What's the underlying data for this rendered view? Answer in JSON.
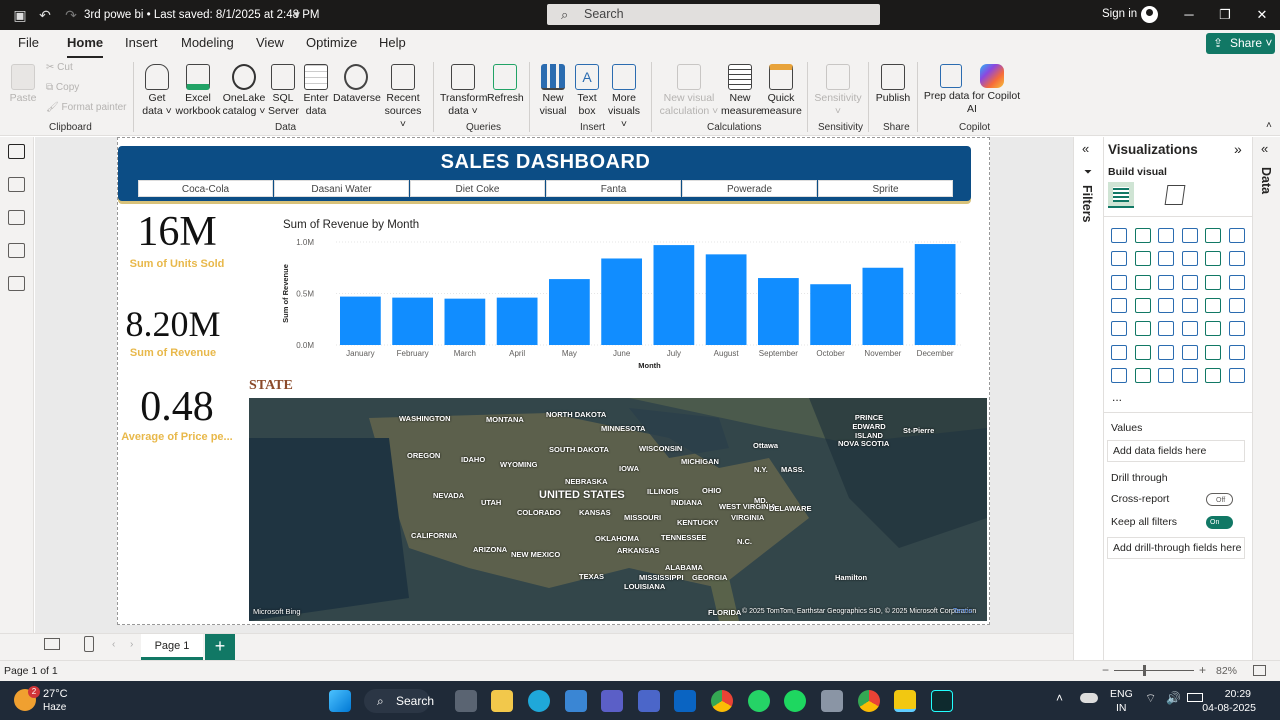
{
  "titlebar": {
    "doc_title": "3rd powe bi  • Last saved: 8/1/2025 at 2:48 PM",
    "search_placeholder": "Search",
    "signin": "Sign in"
  },
  "menu": [
    "File",
    "Home",
    "Insert",
    "Modeling",
    "View",
    "Optimize",
    "Help"
  ],
  "share": "Share",
  "ribbon": {
    "paste": "Paste",
    "cut": "Cut",
    "copy": "Copy",
    "format_painter": "Format painter",
    "get_data": [
      "Get",
      "data ˅"
    ],
    "excel": [
      "Excel",
      "workbook"
    ],
    "onelake": [
      "OneLake",
      "catalog ˅"
    ],
    "sql": [
      "SQL",
      "Server"
    ],
    "enter": [
      "Enter",
      "data"
    ],
    "dataverse": [
      "Dataverse",
      ""
    ],
    "recent": [
      "Recent",
      "sources ˅"
    ],
    "transform": [
      "Transform",
      "data ˅"
    ],
    "refresh": [
      "Refresh",
      ""
    ],
    "new_visual": [
      "New",
      "visual"
    ],
    "text_box": [
      "Text",
      "box"
    ],
    "more_visuals": [
      "More",
      "visuals ˅"
    ],
    "new_visual_calc": [
      "New visual",
      "calculation ˅"
    ],
    "new_measure": [
      "New",
      "measure"
    ],
    "quick_measure": [
      "Quick",
      "measure"
    ],
    "sensitivity": [
      "Sensitivity",
      "˅"
    ],
    "publish": [
      "Publish",
      ""
    ],
    "copilot": [
      "Prep data for Copilot",
      "AI"
    ],
    "groups": {
      "clipboard": "Clipboard",
      "data": "Data",
      "queries": "Queries",
      "insert": "Insert",
      "calculations": "Calculations",
      "sensitivity": "Sensitivity",
      "share": "Share",
      "copilot": "Copilot"
    }
  },
  "dashboard": {
    "title": "SALES DASHBOARD",
    "slicers": [
      "Coca-Cola",
      "Dasani Water",
      "Diet Coke",
      "Fanta",
      "Powerade",
      "Sprite"
    ],
    "kpis": [
      {
        "value": "16M",
        "label": "Sum of Units Sold"
      },
      {
        "value": "8.20M",
        "label": "Sum of Revenue"
      },
      {
        "value": "0.48",
        "label": "Average of Price pe..."
      }
    ],
    "state_title": "STATE",
    "map_labels": [
      "WASHINGTON",
      "MONTANA",
      "NORTH DAKOTA",
      "MINNESOTA",
      "OREGON",
      "IDAHO",
      "SOUTH DAKOTA",
      "WISCONSIN",
      "MICHIGAN",
      "WYOMING",
      "IOWA",
      "NEBRASKA",
      "NEVADA",
      "UTAH",
      "UNITED STATES",
      "ILLINOIS",
      "INDIANA",
      "OHIO",
      "COLORADO",
      "KANSAS",
      "MISSOURI",
      "KENTUCKY",
      "WEST VIRGINIA",
      "VIRGINIA",
      "CALIFORNIA",
      "OKLAHOMA",
      "TENNESSEE",
      "ARIZONA",
      "NEW MEXICO",
      "ARKANSAS",
      "TEXAS",
      "MISSISSIPPI",
      "ALABAMA",
      "GEORGIA",
      "LOUISIANA",
      "FLORIDA",
      "Ottawa",
      "N.Y.",
      "MASS.",
      "PRINCE EDWARD ISLAND",
      "NOVA SCOTIA",
      "St-Pierre",
      "Hamilton",
      "DELAWARE",
      "N.C.",
      "MD."
    ],
    "map_attribution": "© 2025 TomTom, Earthstar Geographics SIO, © 2025 Microsoft Corporation",
    "map_terms": "Terms",
    "map_logo": "Microsoft Bing"
  },
  "chart_data": {
    "type": "bar",
    "title": "Sum of Revenue by Month",
    "xlabel": "Month",
    "ylabel": "Sum of Revenue",
    "categories": [
      "January",
      "February",
      "March",
      "April",
      "May",
      "June",
      "July",
      "August",
      "September",
      "October",
      "November",
      "December"
    ],
    "values": [
      0.47,
      0.46,
      0.45,
      0.46,
      0.64,
      0.84,
      0.97,
      0.88,
      0.65,
      0.59,
      0.75,
      0.98
    ],
    "yticks": [
      "0.0M",
      "0.5M",
      "1.0M"
    ],
    "ylim": [
      0,
      1.0
    ],
    "color": "#118dff"
  },
  "pages": {
    "tab": "Page 1",
    "add": "+",
    "status": "Page 1 of 1",
    "zoom": "82%"
  },
  "viz_pane": {
    "title": "Visualizations",
    "build": "Build visual",
    "filters": "Filters",
    "data": "Data",
    "values": "Values",
    "values_drop": "Add data fields here",
    "drill": "Drill through",
    "cross_report": "Cross-report",
    "cross_state": "Off",
    "keep_filters": "Keep all filters",
    "keep_state": "On",
    "drill_drop": "Add drill-through fields here",
    "more": "..."
  },
  "taskbar": {
    "temp": "27°C",
    "weather": "Haze",
    "search": "Search",
    "lang1": "ENG",
    "lang2": "IN",
    "time": "20:29",
    "date": "04-08-2025",
    "badge": "2"
  }
}
